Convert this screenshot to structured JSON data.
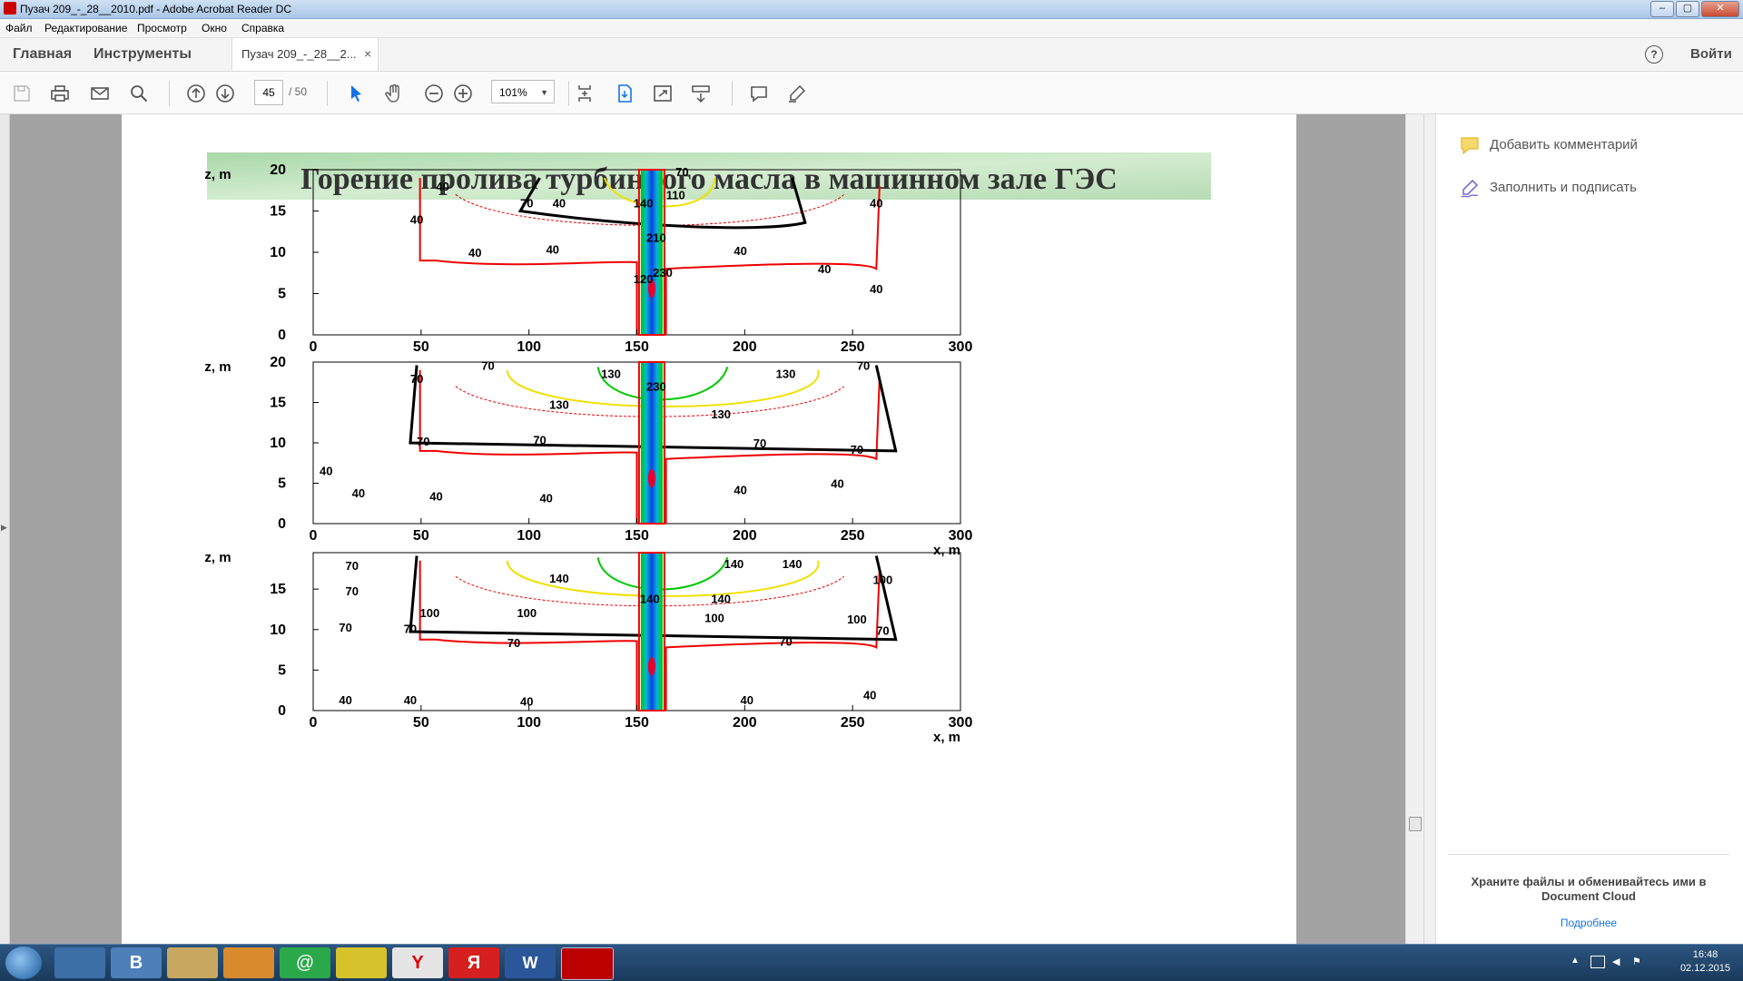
{
  "window": {
    "title": "Пузач 209_-_28__2010.pdf - Adobe Acrobat Reader DC"
  },
  "menu": [
    "Файл",
    "Редактирование",
    "Просмотр",
    "Окно",
    "Справка"
  ],
  "nav": {
    "home": "Главная",
    "tools": "Инструменты",
    "doc_tab": "Пузач 209_-_28__2...",
    "close": "×",
    "help": "?",
    "signin": "Войти"
  },
  "toolbar": {
    "page_current": "45",
    "page_total": "/ 50",
    "zoom": "101%"
  },
  "slide": {
    "title": "Горение пролива турбинного масла в машинном зале ГЭС"
  },
  "plots": [
    {
      "ylabel": "z, m",
      "xlabel": "",
      "yticks": [
        "20",
        "15",
        "10",
        "5",
        "0"
      ],
      "xticks": [
        "0",
        "50",
        "100",
        "150",
        "200",
        "250",
        "300"
      ],
      "contour_labels": [
        "40",
        "70",
        "40",
        "40",
        "40",
        "40",
        "40",
        "40",
        "40",
        "40",
        "140",
        "110",
        "70",
        "210",
        "230",
        "120"
      ]
    },
    {
      "ylabel": "z, m",
      "xlabel": "x, m",
      "yticks": [
        "20",
        "15",
        "10",
        "5",
        "0"
      ],
      "xticks": [
        "0",
        "50",
        "100",
        "150",
        "200",
        "250",
        "300"
      ],
      "contour_labels": [
        "70",
        "70",
        "70",
        "130",
        "130",
        "130",
        "130",
        "230",
        "70",
        "70",
        "70",
        "70",
        "40",
        "40",
        "40",
        "40",
        "40",
        "40"
      ]
    },
    {
      "ylabel": "z, m",
      "xlabel": "x, m",
      "yticks": [
        "15",
        "10",
        "5",
        "0"
      ],
      "xticks": [
        "0",
        "50",
        "100",
        "150",
        "200",
        "250",
        "300"
      ],
      "contour_labels": [
        "70",
        "70",
        "70",
        "70",
        "140",
        "140",
        "140",
        "140",
        "140",
        "100",
        "100",
        "100",
        "100",
        "100",
        "70",
        "70",
        "70",
        "40",
        "40",
        "40",
        "40",
        "40"
      ]
    }
  ],
  "right_panel": {
    "comment": "Добавить комментарий",
    "fill_sign": "Заполнить и подписать",
    "cloud_text": "Храните файлы и обменивайтесь ими в Document Cloud",
    "more": "Подробнее"
  },
  "clock": {
    "time": "16:48",
    "date": "02.12.2015"
  },
  "colors": {
    "contour_hot": "#ee0000",
    "contour_warm": "#f0e000",
    "contour_green": "#00c800",
    "contour_black": "#000000",
    "plume_blue": "#1040e0",
    "plume_cyan": "#00b8d8",
    "plume_red": "#e8002a"
  }
}
